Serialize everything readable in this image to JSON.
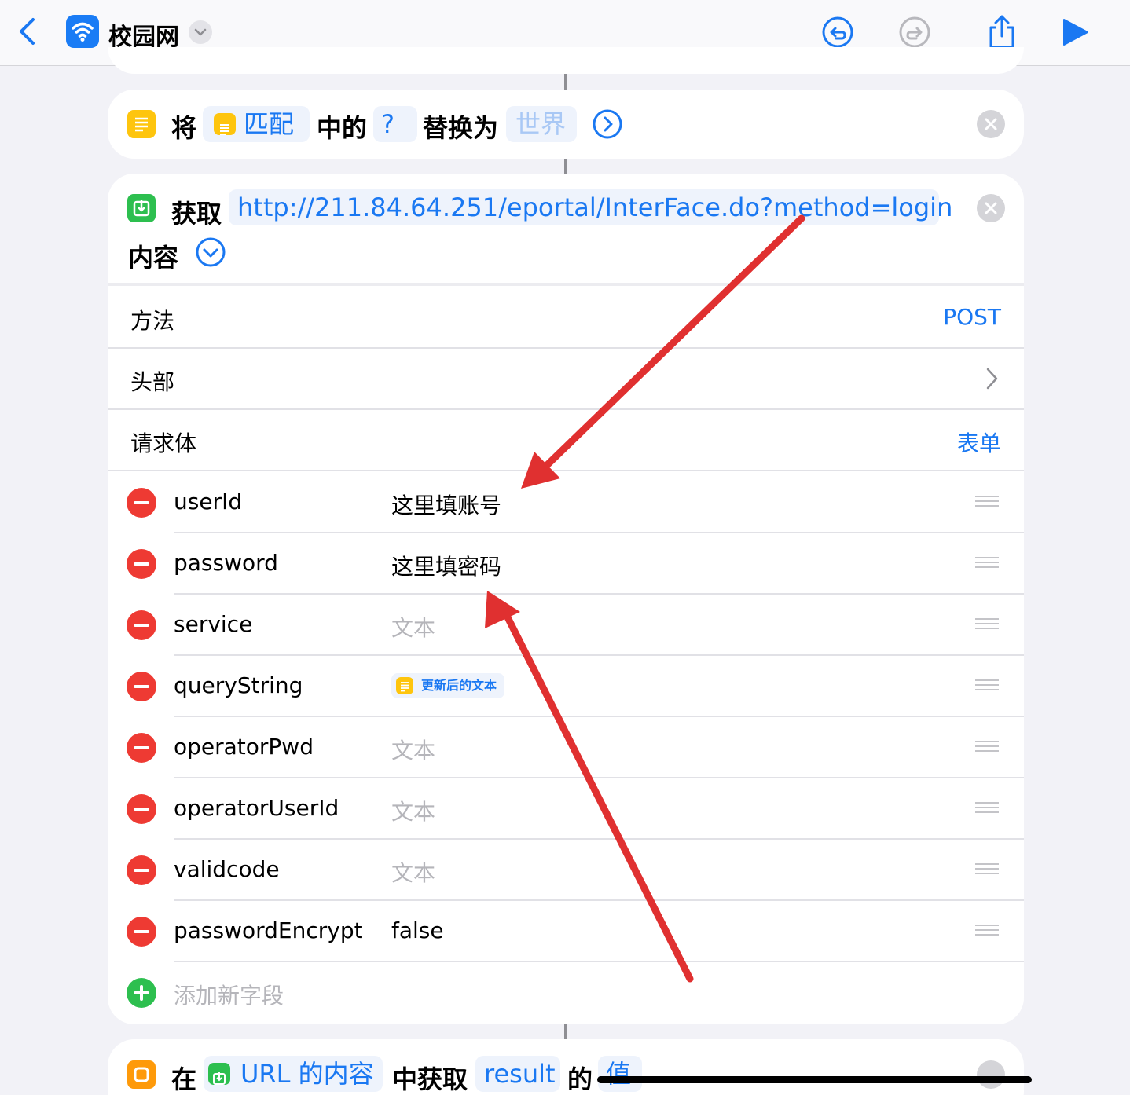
{
  "toolbar": {
    "back_icon": "chevron-left-icon",
    "app_title": "校园网",
    "app_icon": "wifi-icon",
    "undo_icon": "undo-icon",
    "redo_icon": "redo-icon",
    "share_icon": "share-icon",
    "run_icon": "play-icon"
  },
  "replace_action": {
    "verb": "将",
    "input_token": "匹配",
    "middle1": "中的",
    "find_token": "?",
    "middle2": "替换为",
    "replace_token": "世界"
  },
  "fetch_action": {
    "verb": "获取",
    "url": "http://211.84.64.251/eportal/InterFace.do?method=login",
    "suffix": "内容",
    "method_label": "方法",
    "method_value": "POST",
    "headers_label": "头部",
    "body_label": "请求体",
    "body_value": "表单",
    "fields": [
      {
        "key": "userId",
        "value": "这里填账号"
      },
      {
        "key": "password",
        "value": "这里填密码"
      },
      {
        "key": "service",
        "value": "文本"
      },
      {
        "key": "queryString",
        "value": "更新后的文本"
      },
      {
        "key": "operatorPwd",
        "value": "文本"
      },
      {
        "key": "operatorUserId",
        "value": "文本"
      },
      {
        "key": "validcode",
        "value": "文本"
      },
      {
        "key": "passwordEncrypt",
        "value": "false"
      }
    ],
    "add_field_label": "添加新字段"
  },
  "dict_action": {
    "verb": "在",
    "input_token": "URL 的内容",
    "middle": "中获取",
    "key_token": "result",
    "suffix": "的",
    "value_token": "值"
  },
  "colors": {
    "accent": "#1a78f2",
    "annotation_arrow": "#e03030",
    "text_action_icon": "#fec50e",
    "url_action_icon": "#2dbf4f",
    "dict_action_icon": "#fe9a0a",
    "delete_red": "#ee3a33"
  }
}
